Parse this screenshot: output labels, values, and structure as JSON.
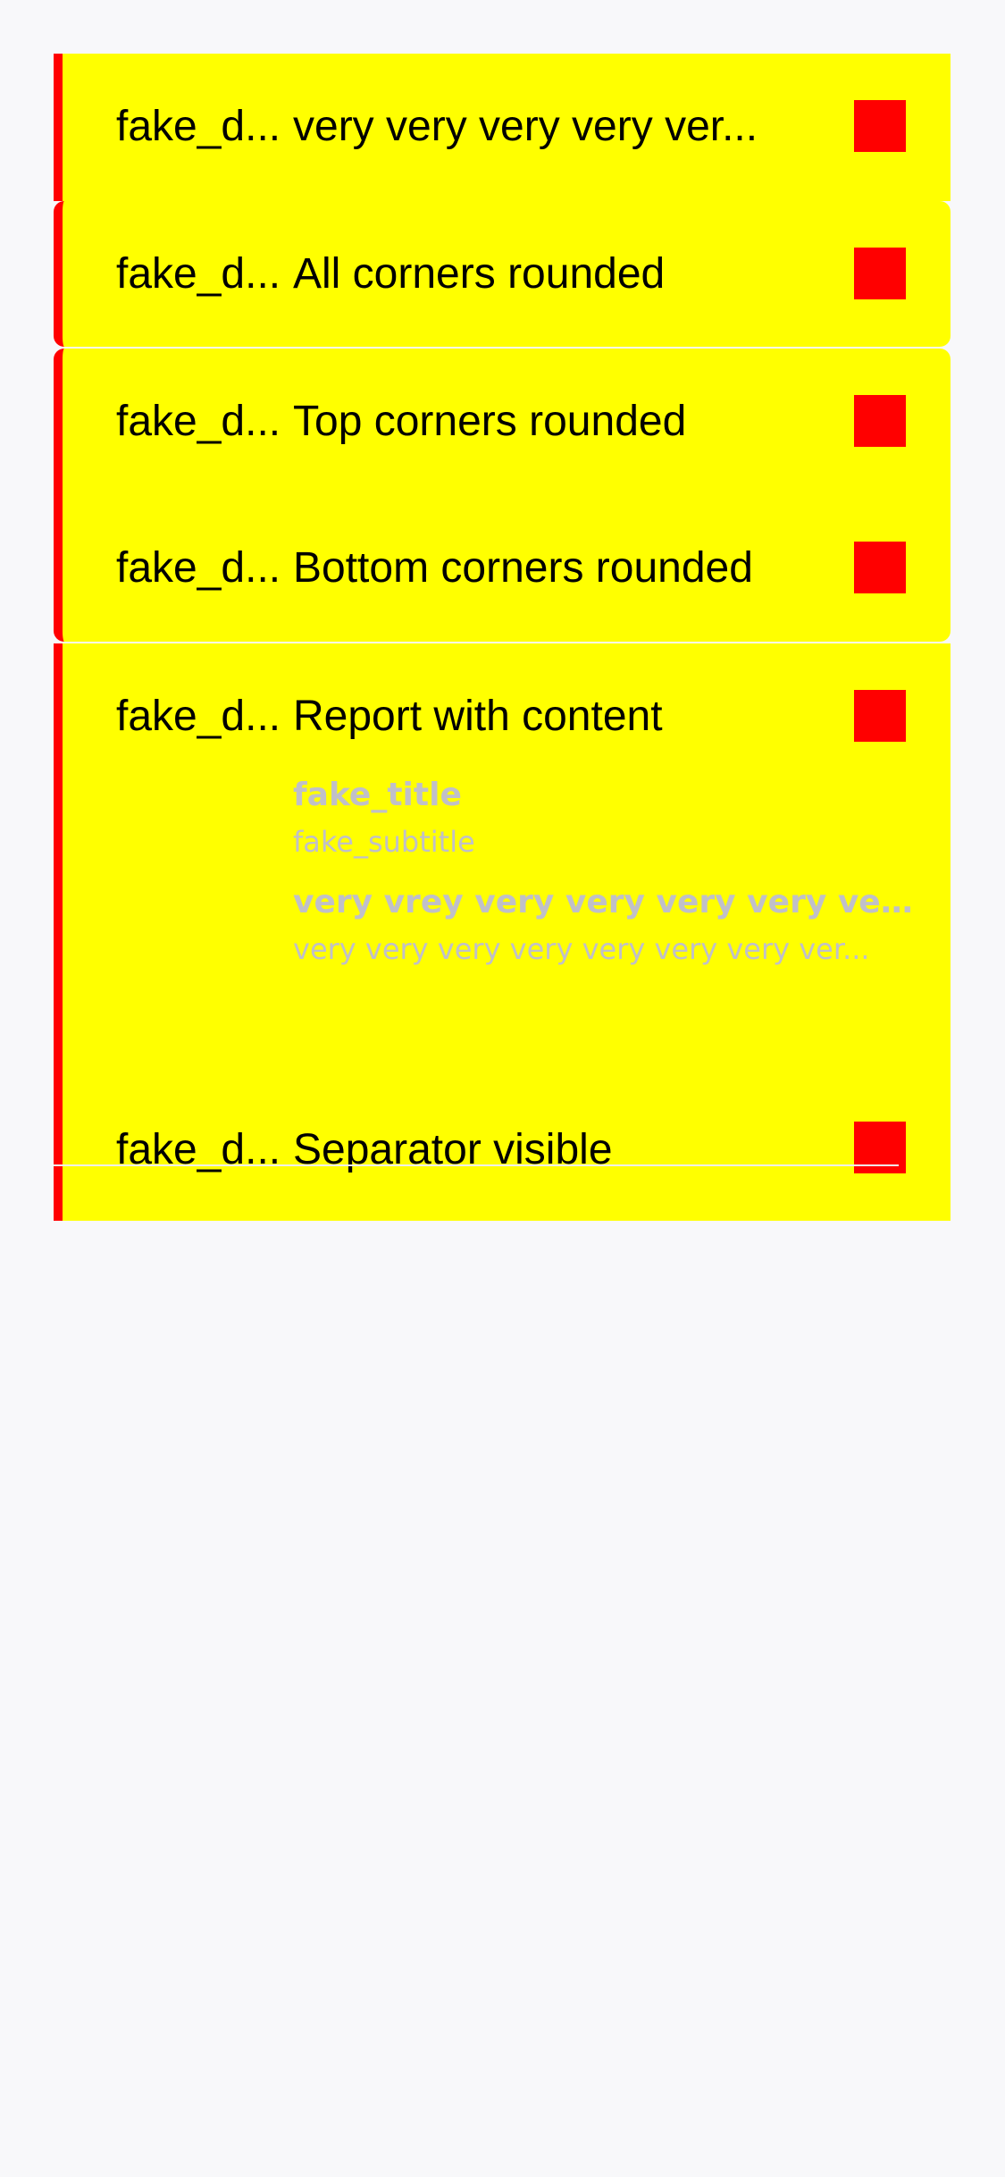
{
  "colors": {
    "background": "#f8f8fa",
    "cell_background": "#ffff00",
    "accent": "#ff0000",
    "content_text": "#c0c0c8"
  },
  "rows": [
    {
      "date": "fake_d...",
      "title": "very very very very ver...",
      "badge_icon": "red-square-icon"
    },
    {
      "date": "fake_d...",
      "title": "All corners rounded",
      "badge_icon": "red-square-icon"
    },
    {
      "date": "fake_d...",
      "title": "Top corners rounded",
      "badge_icon": "red-square-icon"
    },
    {
      "date": "fake_d...",
      "title": "Bottom corners rounded",
      "badge_icon": "red-square-icon"
    },
    {
      "date": "fake_d...",
      "title": "Report with content",
      "badge_icon": "red-square-icon",
      "content": {
        "title": "fake_title",
        "subtitle": "fake_subtitle",
        "body_bold": "very vrey very very very very very...",
        "body": "very very very very very very very ver..."
      }
    },
    {
      "date": "fake_d...",
      "title": "Separator visible",
      "badge_icon": "red-square-icon"
    }
  ]
}
